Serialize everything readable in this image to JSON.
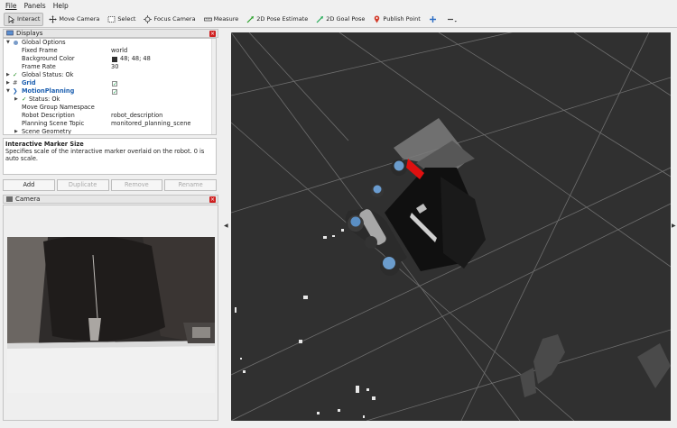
{
  "menu": [
    "File",
    "Panels",
    "Help"
  ],
  "toolbar": [
    {
      "label": "Interact",
      "icon": "interact-icon",
      "active": true
    },
    {
      "label": "Move Camera",
      "icon": "move-camera-icon"
    },
    {
      "label": "Select",
      "icon": "select-icon"
    },
    {
      "label": "Focus Camera",
      "icon": "focus-camera-icon"
    },
    {
      "label": "Measure",
      "icon": "measure-icon"
    },
    {
      "label": "2D Pose Estimate",
      "icon": "pose-estimate-icon"
    },
    {
      "label": "2D Goal Pose",
      "icon": "goal-pose-icon"
    },
    {
      "label": "Publish Point",
      "icon": "publish-point-icon"
    }
  ],
  "displays": {
    "title": "Displays",
    "rows": [
      {
        "label": "Global Options",
        "indent": 0,
        "arrow": "down",
        "icon": "globe-icon"
      },
      {
        "label": "Fixed Frame",
        "indent": 2,
        "value": "world"
      },
      {
        "label": "Background Color",
        "indent": 2,
        "value": "48; 48; 48",
        "swatch": "#303030"
      },
      {
        "label": "Frame Rate",
        "indent": 2,
        "value": "30"
      },
      {
        "label": "Global Status: Ok",
        "indent": 0,
        "arrow": "right",
        "icon": "check-icon"
      },
      {
        "label": "Grid",
        "indent": 0,
        "arrow": "right",
        "icon": "grid-icon",
        "blue": true,
        "checked": true
      },
      {
        "label": "MotionPlanning",
        "indent": 0,
        "arrow": "down",
        "icon": "motion-planning-icon",
        "blue": true,
        "checked": true
      },
      {
        "label": "Status: Ok",
        "indent": 1,
        "arrow": "right",
        "icon": "check-icon"
      },
      {
        "label": "Move Group Namespace",
        "indent": 2,
        "value": ""
      },
      {
        "label": "Robot Description",
        "indent": 2,
        "value": "robot_description"
      },
      {
        "label": "Planning Scene Topic",
        "indent": 2,
        "value": "monitored_planning_scene"
      },
      {
        "label": "Scene Geometry",
        "indent": 1,
        "arrow": "right"
      }
    ]
  },
  "description": {
    "title": "Interactive Marker Size",
    "text": "Specifies scale of the interactive marker overlaid on the robot. 0 is auto scale."
  },
  "buttons": {
    "add": "Add",
    "duplicate": "Duplicate",
    "remove": "Remove",
    "rename": "Rename"
  },
  "camera": {
    "title": "Camera"
  },
  "colors": {
    "background": "#303030",
    "grid": "#6e6e6e",
    "accent": "#1c5fb0",
    "close": "#cf1f1f",
    "goal_marker": "#e01010"
  }
}
